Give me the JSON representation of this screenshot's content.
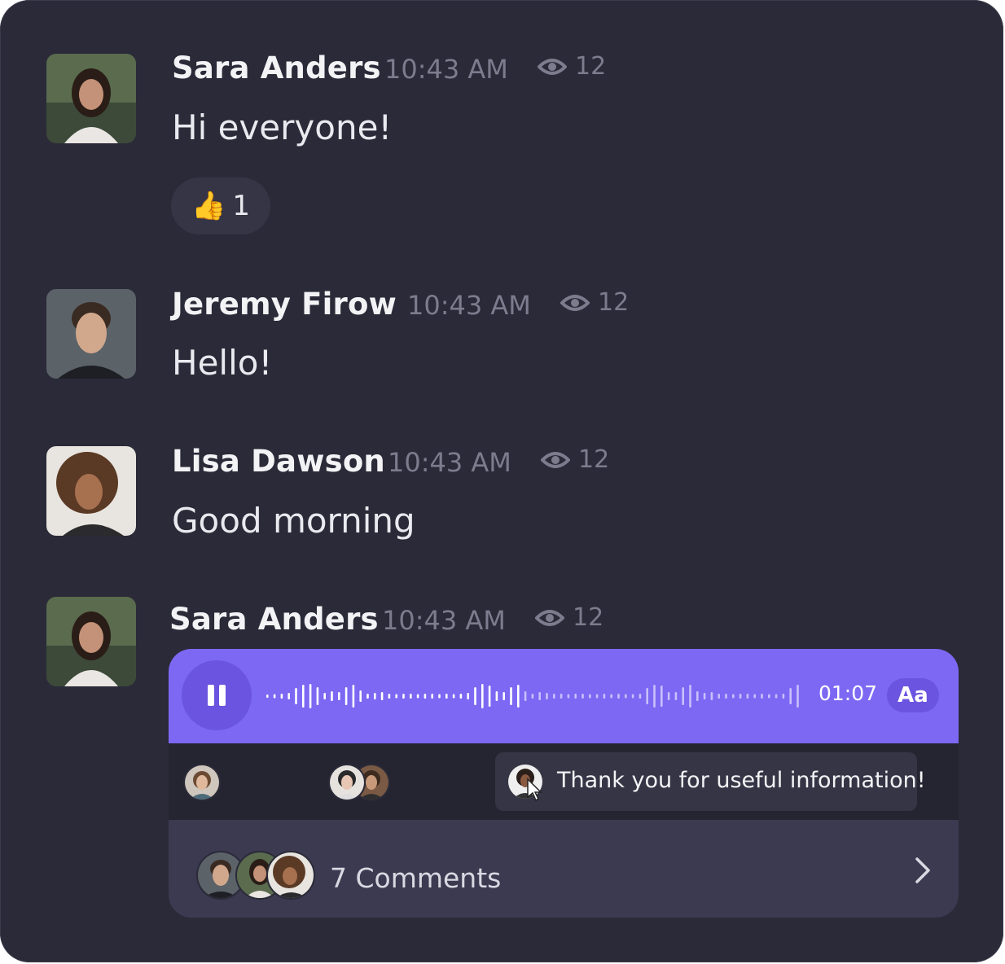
{
  "messages": [
    {
      "author": "Sara Anders",
      "time": "10:43 AM",
      "views": "12",
      "text": "Hi everyone!",
      "reaction": {
        "emoji": "👍",
        "count": "1"
      }
    },
    {
      "author": "Jeremy Firow",
      "time": "10:43 AM",
      "views": "12",
      "text": "Hello!"
    },
    {
      "author": "Lisa Dawson",
      "time": "10:43 AM",
      "views": "12",
      "text": "Good morning"
    },
    {
      "author": "Sara Anders",
      "time": "10:43 AM",
      "views": "12",
      "voice": {
        "duration": "01:07",
        "transcript_toggle": "Aa",
        "state": "playing",
        "accent": "#7d68f3"
      },
      "thread_reply": "Thank you for useful information!",
      "comments": "7 Comments"
    }
  ],
  "icons": [
    "eye-icon",
    "pause-icon",
    "chevron-right-icon",
    "thumbs-up-icon",
    "cursor-icon"
  ],
  "colors": {
    "background": "#2a2a38",
    "accent": "#7d68f3",
    "muted": "#7c7c8e"
  }
}
